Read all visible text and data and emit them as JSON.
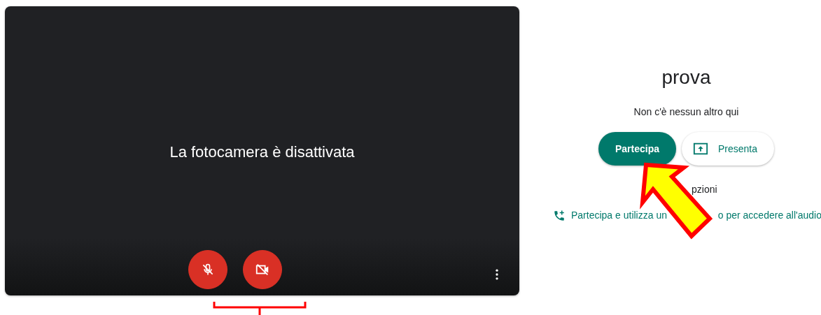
{
  "preview": {
    "message": "La fotocamera è disattivata",
    "controls": [
      {
        "kind": "microphone",
        "on": false
      },
      {
        "kind": "camera",
        "on": false
      }
    ]
  },
  "meeting": {
    "title": "prova",
    "status": "Non c'è nessun altro qui",
    "buttons": [
      {
        "kind": "join",
        "label": "Partecipa"
      },
      {
        "kind": "present",
        "label": "Presenta"
      }
    ],
    "options_label": "pzioni",
    "phone_link": [
      "Partecipa e utilizza un",
      "o per accedere all'audio"
    ]
  }
}
